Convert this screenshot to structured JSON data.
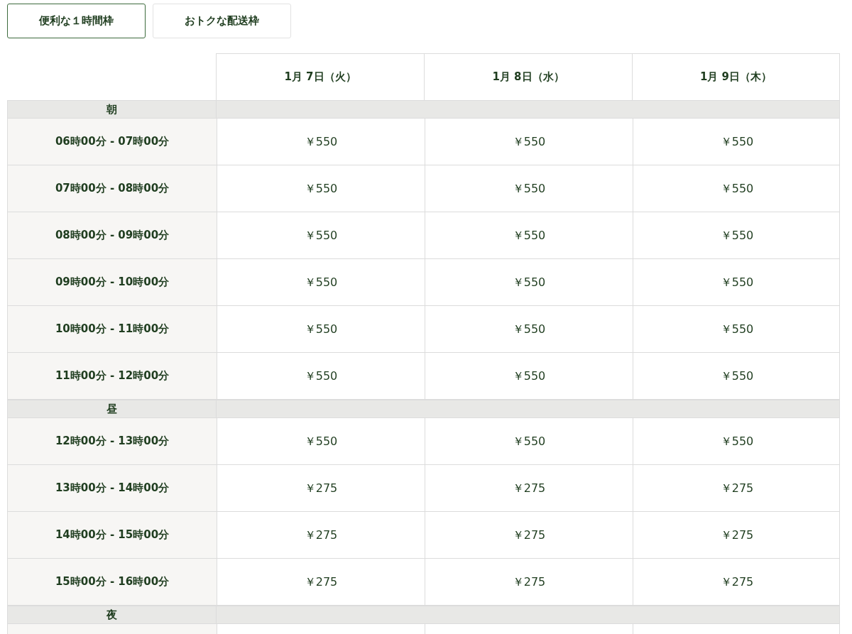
{
  "tabs": [
    {
      "label": "便利な１時間枠",
      "selected": true
    },
    {
      "label": "おトクな配送枠",
      "selected": false
    }
  ],
  "table": {
    "columns": [
      "1月 7日（火）",
      "1月 8日（水）",
      "1月 9日（木）"
    ],
    "sections": [
      {
        "label": "朝",
        "rows": [
          {
            "time": "06時00分 - 07時00分",
            "prices": [
              "￥550",
              "￥550",
              "￥550"
            ]
          },
          {
            "time": "07時00分 - 08時00分",
            "prices": [
              "￥550",
              "￥550",
              "￥550"
            ]
          },
          {
            "time": "08時00分 - 09時00分",
            "prices": [
              "￥550",
              "￥550",
              "￥550"
            ]
          },
          {
            "time": "09時00分 - 10時00分",
            "prices": [
              "￥550",
              "￥550",
              "￥550"
            ]
          },
          {
            "time": "10時00分 - 11時00分",
            "prices": [
              "￥550",
              "￥550",
              "￥550"
            ]
          },
          {
            "time": "11時00分 - 12時00分",
            "prices": [
              "￥550",
              "￥550",
              "￥550"
            ]
          }
        ]
      },
      {
        "label": "昼",
        "rows": [
          {
            "time": "12時00分 - 13時00分",
            "prices": [
              "￥550",
              "￥550",
              "￥550"
            ]
          },
          {
            "time": "13時00分 - 14時00分",
            "prices": [
              "￥275",
              "￥275",
              "￥275"
            ]
          },
          {
            "time": "14時00分 - 15時00分",
            "prices": [
              "￥275",
              "￥275",
              "￥275"
            ]
          },
          {
            "time": "15時00分 - 16時00分",
            "prices": [
              "￥275",
              "￥275",
              "￥275"
            ]
          }
        ]
      },
      {
        "label": "夜"
      }
    ]
  }
}
